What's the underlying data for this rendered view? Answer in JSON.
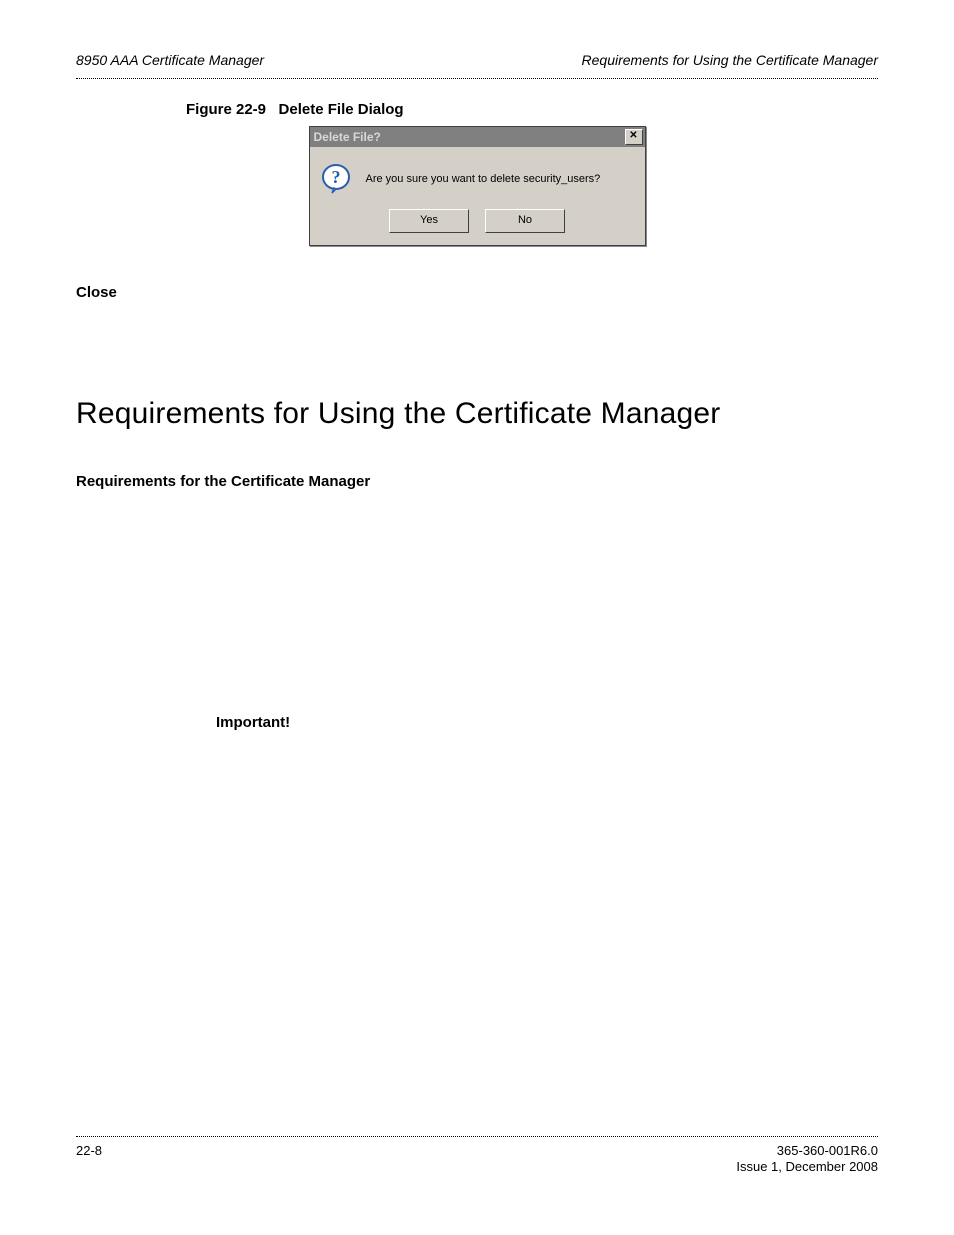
{
  "header": {
    "left": "8950 AAA Certificate Manager",
    "right": "Requirements for Using the Certificate Manager"
  },
  "figure": {
    "caption_num": "Figure 22-9",
    "caption_title": "Delete File Dialog"
  },
  "dialog": {
    "title": "Delete File?",
    "close_glyph": "✕",
    "message": "Are you sure you want to delete security_users?",
    "yes_label": "Yes",
    "no_label": "No"
  },
  "body": {
    "close_heading": "Close",
    "section_title": "Requirements for Using the Certificate Manager",
    "subheading": "Requirements for the Certificate Manager",
    "important_label": "Important!"
  },
  "footer": {
    "page_num": "22-8",
    "doc_id": "365-360-001R6.0",
    "issue": "Issue 1, December 2008"
  }
}
